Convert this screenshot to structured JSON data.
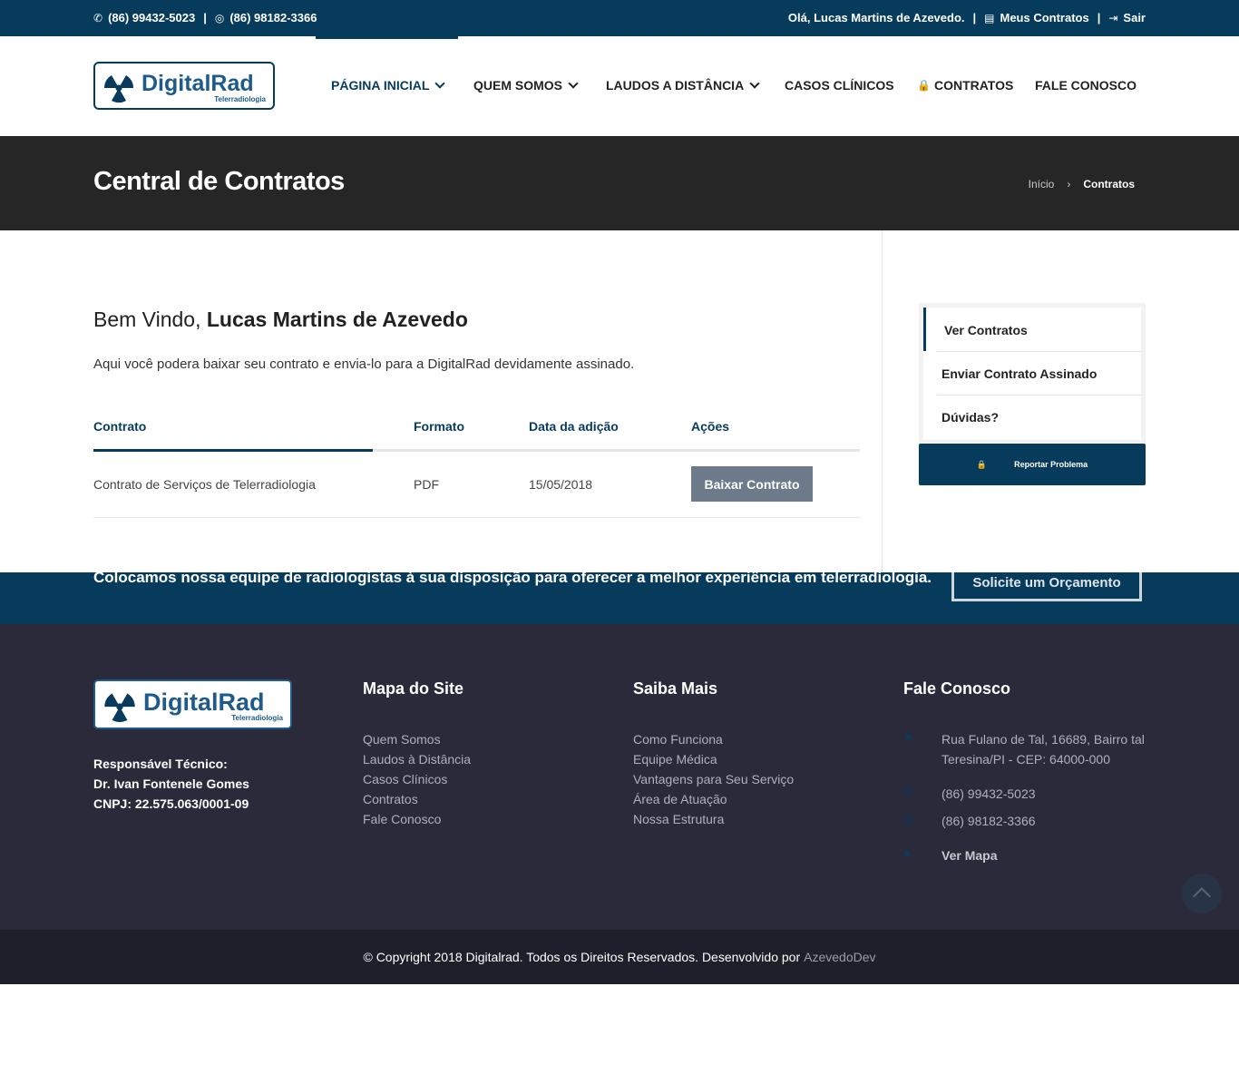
{
  "topbar": {
    "phone1": "(86) 99432-5023",
    "phone2": "(86) 98182-3366",
    "greeting": "Olá, Lucas Martins de Azevedo.",
    "my_contracts": "Meus Contratos",
    "logout": "Sair"
  },
  "brand": {
    "name": "DigitalRad",
    "tagline": "Telerradiologia"
  },
  "nav": {
    "home": "PÁGINA INICIAL",
    "about": "QUEM SOMOS",
    "remote": "LAUDOS A DISTÂNCIA",
    "cases": "CASOS CLÍNICOS",
    "contracts": "CONTRATOS",
    "contact": "FALE CONOSCO"
  },
  "page": {
    "title": "Central de Contratos",
    "breadcrumb": [
      "Início",
      "Contratos"
    ]
  },
  "main": {
    "welcome_prefix": "Bem Vindo,",
    "user_name": "Lucas Martins de Azevedo",
    "intro": "Aqui você podera baixar seu contrato e envia-lo para a DigitalRad devidamente assinado.",
    "table": {
      "headers": [
        "Contrato",
        "Formato",
        "Data da adição",
        "Ações"
      ],
      "rows": [
        {
          "name": "Contrato de Serviços de Telerradiologia",
          "format": "PDF",
          "date": "15/05/2018",
          "action": "Baixar Contrato"
        }
      ]
    }
  },
  "sidebar": {
    "items": [
      "Ver Contratos",
      "Enviar Contrato Assinado",
      "Dúvidas?"
    ],
    "report": "Reportar Problema"
  },
  "cta": {
    "text": "Colocamos nossa equipe de radiologistas à sua disposição para oferecer a melhor experiência em telerradiologia.",
    "button": "Solicite um Orçamento"
  },
  "footer": {
    "resp_title": "Responsável Técnico:",
    "resp_name": "Dr. Ivan Fontenele Gomes",
    "cnpj": "CNPJ: 22.575.063/0001-09",
    "sitemap": {
      "title": "Mapa do Site",
      "links": [
        "Quem Somos",
        "Laudos à Distância",
        "Casos Clínicos",
        "Contratos",
        "Fale Conosco"
      ]
    },
    "more": {
      "title": "Saiba Mais",
      "links": [
        "Como Funciona",
        "Equipe Médica",
        "Vantagens para Seu Serviço",
        "Área de Atuação",
        "Nossa Estrutura"
      ]
    },
    "contact": {
      "title": "Fale Conosco",
      "address1": "Rua Fulano de Tal, 16689, Bairro tal",
      "address2": "Teresina/PI - CEP: 64000-000",
      "phone1": "(86) 99432-5023",
      "phone2": "(86) 98182-3366",
      "map": "Ver Mapa"
    },
    "copyright": "© Copyright 2018 Digitalrad. Todos os Direitos Reservados. Desenvolvido por",
    "developer": "AzevedoDev"
  },
  "colors": {
    "primary": "#063b5c",
    "dark_band": "#262626",
    "footer": "#2a2a3a",
    "button_gray": "#6c7a8a"
  }
}
